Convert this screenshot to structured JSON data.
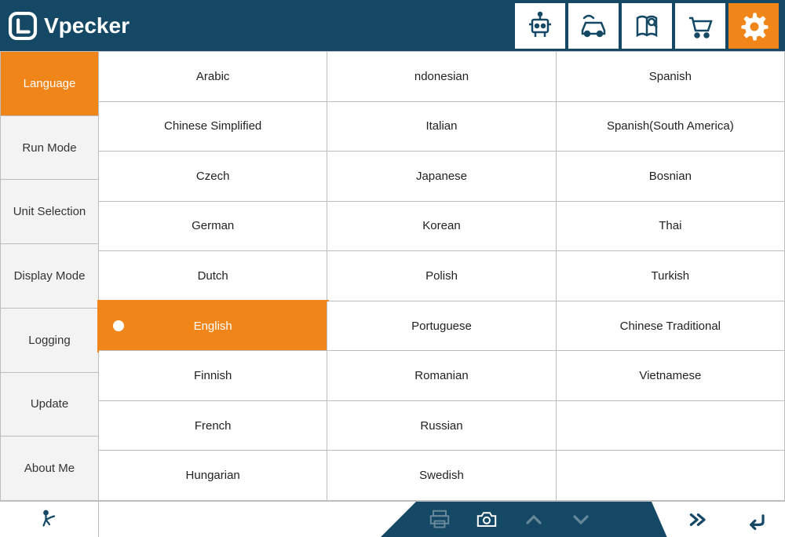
{
  "app": {
    "name": "Vpecker"
  },
  "header_icons": [
    "robot-icon",
    "car-icon",
    "book-icon",
    "cart-icon",
    "gear-icon"
  ],
  "header_active_index": 4,
  "sidebar": {
    "items": [
      {
        "label": "Language"
      },
      {
        "label": "Run Mode"
      },
      {
        "label": "Unit Selection"
      },
      {
        "label": "Display Mode"
      },
      {
        "label": "Logging"
      },
      {
        "label": "Update"
      },
      {
        "label": "About Me"
      }
    ],
    "active_index": 0
  },
  "languages": {
    "columns": [
      [
        "Arabic",
        "Chinese Simplified",
        "Czech",
        "German",
        "Dutch",
        "English",
        "Finnish",
        "French",
        "Hungarian"
      ],
      [
        "ndonesian",
        "Italian",
        "Japanese",
        "Korean",
        "Polish",
        "Portuguese",
        "Romanian",
        "Russian",
        "Swedish"
      ],
      [
        "Spanish",
        "Spanish(South America)",
        "Bosnian",
        "Thai",
        "Turkish",
        "Chinese Traditional",
        "Vietnamese",
        "",
        ""
      ]
    ],
    "selected": "English"
  },
  "footer_icons": [
    "run-icon",
    "print-icon",
    "camera-icon",
    "up-icon",
    "down-icon",
    "next-icon",
    "back-icon"
  ]
}
